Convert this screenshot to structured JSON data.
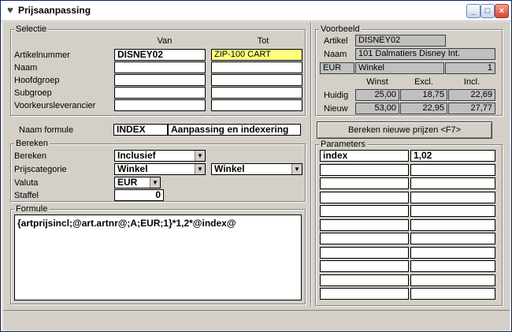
{
  "window": {
    "title": "Prijsaanpassing"
  },
  "selectie": {
    "label": "Selectie",
    "col_van": "Van",
    "col_tot": "Tot",
    "rows": [
      {
        "label": "Artikelnummer",
        "van": "DISNEY02",
        "tot": "ZIP-100 CART"
      },
      {
        "label": "Naam",
        "van": "",
        "tot": ""
      },
      {
        "label": "Hoofdgroep",
        "van": "",
        "tot": ""
      },
      {
        "label": "Subgroep",
        "van": "",
        "tot": ""
      },
      {
        "label": "Voorkeursleverancier",
        "van": "",
        "tot": ""
      }
    ]
  },
  "voorbeeld": {
    "label": "Voorbeeld",
    "artikel_label": "Artikel",
    "artikel_value": "DISNEY02",
    "naam_label": "Naam",
    "naam_value": "101 Dalmatiers Disney Int.",
    "valuta": "EUR",
    "categorie": "Winkel",
    "staffel": "1",
    "col_winst": "Winst",
    "col_excl": "Excl.",
    "col_incl": "Incl.",
    "huidig_label": "Huidig",
    "huidig": [
      "25,00",
      "18,75",
      "22,69"
    ],
    "nieuw_label": "Nieuw",
    "nieuw": [
      "53,00",
      "22,95",
      "27,77"
    ]
  },
  "formule": {
    "naam_label": "Naam formule",
    "code": "INDEX",
    "omschrijving": "Aanpassing en indexering",
    "bereken_group": "Bereken",
    "bereken_label": "Bereken",
    "bereken_value": "Inclusief",
    "prijscategorie_label": "Prijscategorie",
    "prijscategorie_van": "Winkel",
    "prijscategorie_tot": "Winkel",
    "valuta_label": "Valuta",
    "valuta_value": "EUR",
    "staffel_label": "Staffel",
    "staffel_value": "0",
    "formule_label": "Formule",
    "formule_text": "{artprijsincl;@art.artnr@;A;EUR;1}*1,2*@index@"
  },
  "calc_button": "Bereken nieuwe prijzen <F7>",
  "parameters": {
    "label": "Parameters",
    "rows": [
      {
        "name": "index",
        "value": "1,02"
      },
      {
        "name": "",
        "value": ""
      },
      {
        "name": "",
        "value": ""
      },
      {
        "name": "",
        "value": ""
      },
      {
        "name": "",
        "value": ""
      },
      {
        "name": "",
        "value": ""
      },
      {
        "name": "",
        "value": ""
      },
      {
        "name": "",
        "value": ""
      },
      {
        "name": "",
        "value": ""
      },
      {
        "name": "",
        "value": ""
      },
      {
        "name": "",
        "value": ""
      }
    ]
  }
}
